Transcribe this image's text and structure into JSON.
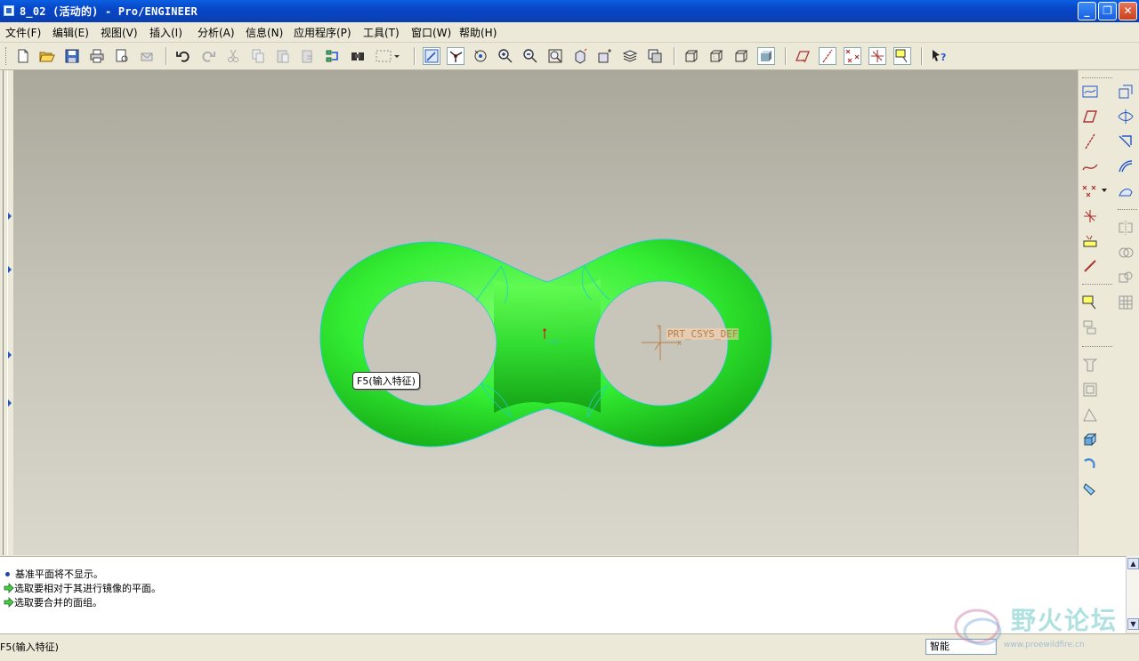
{
  "window": {
    "title": "8_02 (活动的) - Pro/ENGINEER"
  },
  "menu": {
    "items": [
      "文件(F)",
      "编辑(E)",
      "视图(V)",
      "插入(I)",
      "分析(A)",
      "信息(N)",
      "应用程序(P)",
      "工具(T)",
      "窗口(W)",
      "帮助(H)"
    ]
  },
  "viewport": {
    "tooltip": "F5(输入特征)",
    "csys_label": "PRT_CSYS_DEF",
    "model_color": "#33ee33",
    "edge_color": "#22cccc",
    "background_top": "#aaa89b",
    "background_bottom": "#dad8cc"
  },
  "messages": [
    {
      "type": "info",
      "text": "基准平面将不显示。"
    },
    {
      "type": "prompt",
      "text": "选取要相对于其进行镜像的平面。"
    },
    {
      "type": "prompt",
      "text": "选取要合并的面组。"
    }
  ],
  "status": {
    "text": "F5(输入特征)",
    "filter": "智能"
  },
  "watermark": {
    "text": "野火论坛",
    "subtitle": "www.proewildfire.cn"
  }
}
